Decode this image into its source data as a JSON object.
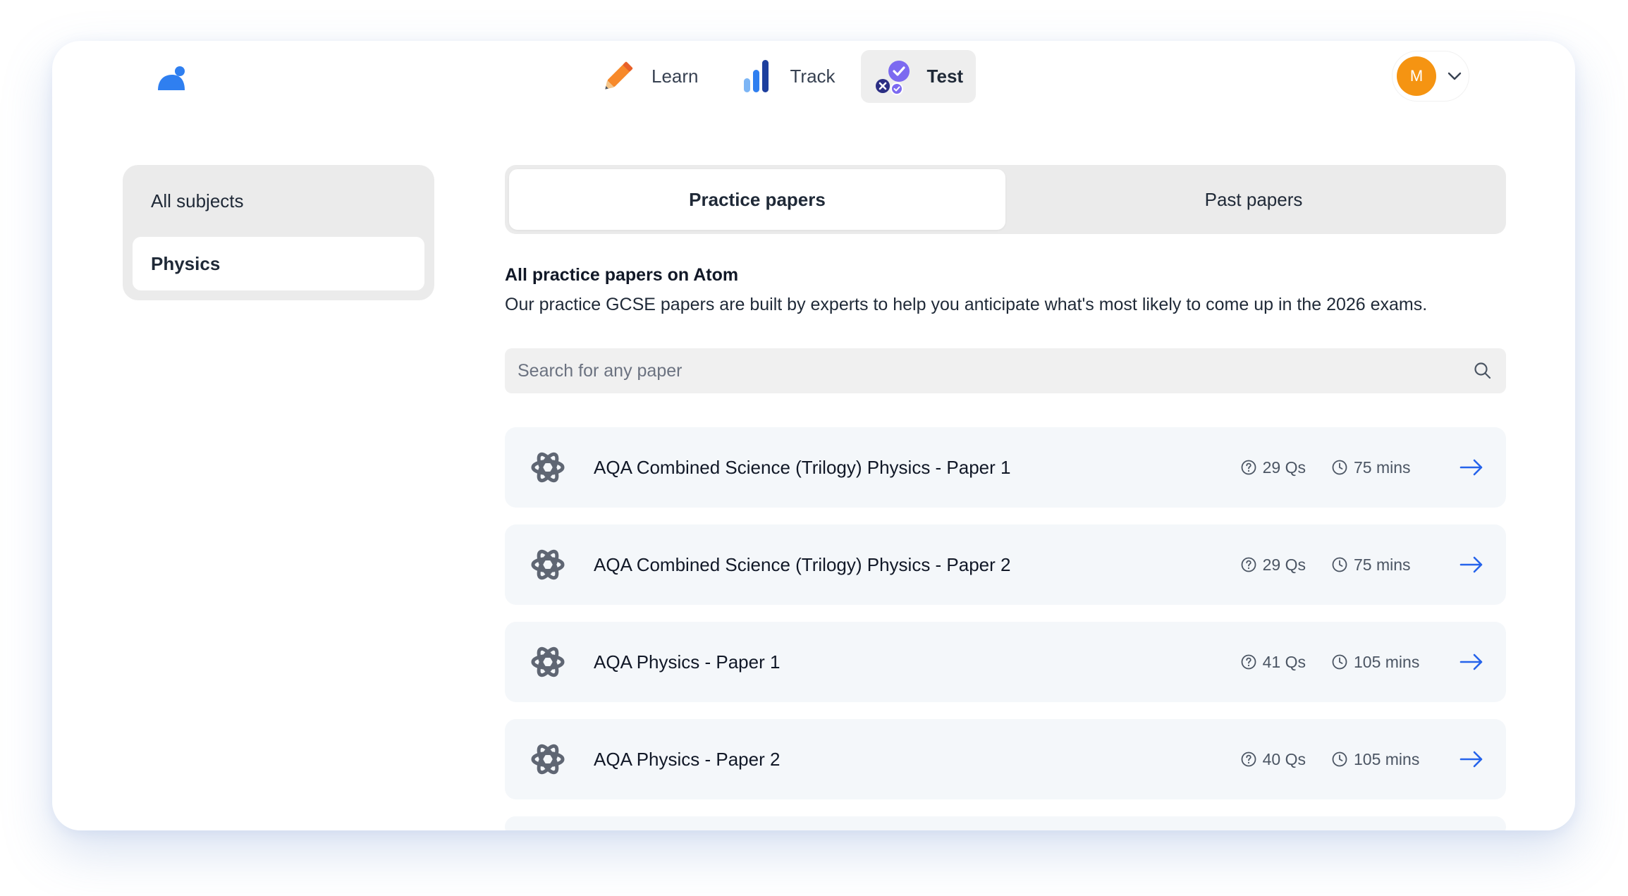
{
  "header": {
    "logo_icon": "atom-logo-icon",
    "nav": [
      {
        "label": "Learn",
        "icon": "pencil-icon",
        "active": false
      },
      {
        "label": "Track",
        "icon": "bar-chart-icon",
        "active": false
      },
      {
        "label": "Test",
        "icon": "test-check-icon",
        "active": true
      }
    ],
    "user": {
      "initial": "M",
      "avatar_color": "#F59412",
      "menu_icon": "chevron-down-icon"
    }
  },
  "sidebar": {
    "items": [
      {
        "label": "All subjects",
        "active": false
      },
      {
        "label": "Physics",
        "active": true
      }
    ]
  },
  "tabs": [
    {
      "label": "Practice papers",
      "active": true
    },
    {
      "label": "Past papers",
      "active": false
    }
  ],
  "intro": {
    "title": "All practice papers on Atom",
    "description": "Our practice GCSE papers are built by experts to help you anticipate what's most likely to come up in the 2026 exams."
  },
  "search": {
    "placeholder": "Search for any paper",
    "value": ""
  },
  "papers": [
    {
      "title": "AQA Combined Science (Trilogy) Physics - Paper 1",
      "questions": "29 Qs",
      "duration": "75 mins"
    },
    {
      "title": "AQA Combined Science (Trilogy) Physics - Paper 2",
      "questions": "29 Qs",
      "duration": "75 mins"
    },
    {
      "title": "AQA Physics - Paper 1",
      "questions": "41 Qs",
      "duration": "105 mins"
    },
    {
      "title": "AQA Physics - Paper 2",
      "questions": "40 Qs",
      "duration": "105 mins"
    }
  ],
  "colors": {
    "accent": "#2563EB",
    "brand_blue": "#2F7FF0",
    "icon_gray": "#5F6673"
  }
}
